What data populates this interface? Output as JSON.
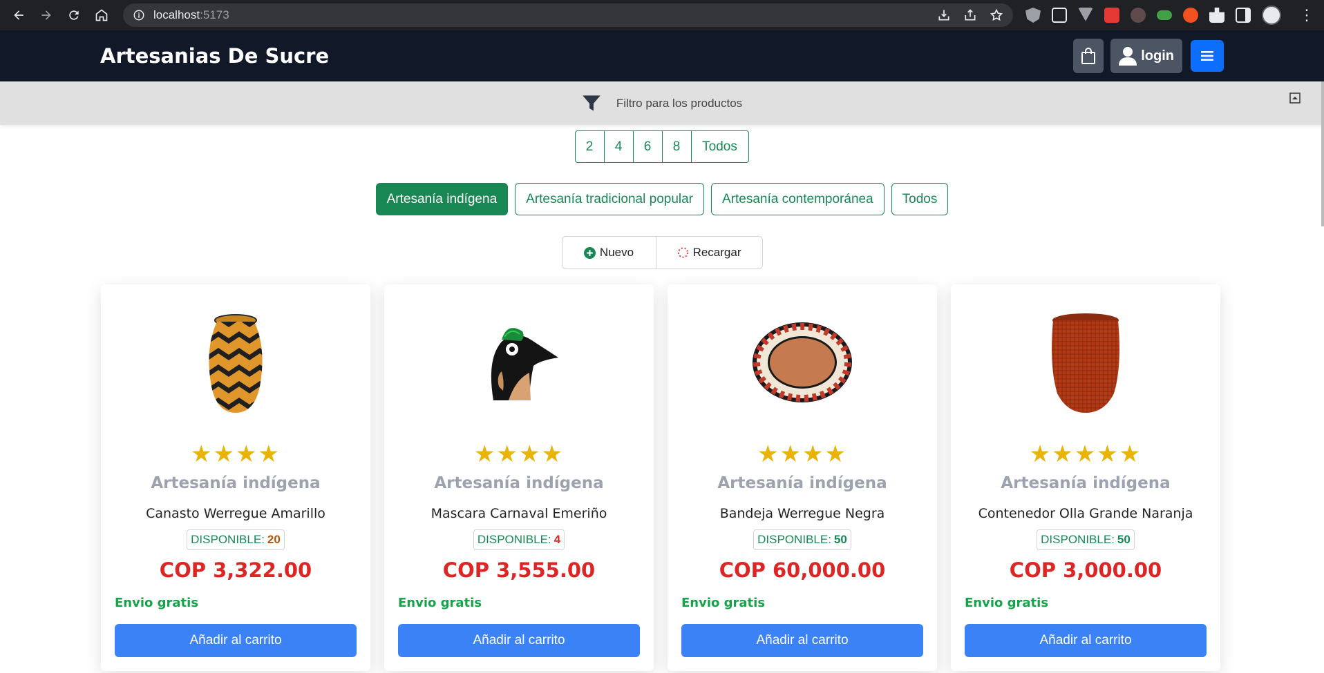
{
  "browser": {
    "url_host": "localhost",
    "url_port": ":5173"
  },
  "header": {
    "brand": "Artesanias De Sucre",
    "login_label": "login"
  },
  "filter": {
    "label": "Filtro para los productos"
  },
  "pagination": [
    "2",
    "4",
    "6",
    "8",
    "Todos"
  ],
  "categories": [
    {
      "label": "Artesanía indígena",
      "active": true
    },
    {
      "label": "Artesanía tradicional popular",
      "active": false
    },
    {
      "label": "Artesanía contemporánea",
      "active": false
    },
    {
      "label": "Todos",
      "active": false
    }
  ],
  "actions": {
    "new_label": "Nuevo",
    "reload_label": "Recargar"
  },
  "products": [
    {
      "stars": "★★★★",
      "category": "Artesanía indígena",
      "name": "Canasto Werregue Amarillo",
      "avail_label": "DISPONIBLE:",
      "qty": "20",
      "price": "COP 3,322.00",
      "shipping": "Envio gratis",
      "button": "Añadir al carrito"
    },
    {
      "stars": "★★★★",
      "category": "Artesanía indígena",
      "name": "Mascara Carnaval Emeriño",
      "avail_label": "DISPONIBLE:",
      "qty": "4",
      "price": "COP 3,555.00",
      "shipping": "Envio gratis",
      "button": "Añadir al carrito"
    },
    {
      "stars": "★★★★",
      "category": "Artesanía indígena",
      "name": "Bandeja Werregue Negra",
      "avail_label": "DISPONIBLE:",
      "qty": "50",
      "price": "COP 60,000.00",
      "shipping": "Envio gratis",
      "button": "Añadir al carrito"
    },
    {
      "stars": "★★★★★",
      "category": "Artesanía indígena",
      "name": "Contenedor Olla Grande Naranja",
      "avail_label": "DISPONIBLE:",
      "qty": "50",
      "price": "COP 3,000.00",
      "shipping": "Envio gratis",
      "button": "Añadir al carrito"
    }
  ],
  "colors": {
    "header_bg": "#111827",
    "accent_green": "#198754",
    "price_red": "#dc2626",
    "button_blue": "#3b82f6",
    "star_yellow": "#eab308"
  }
}
